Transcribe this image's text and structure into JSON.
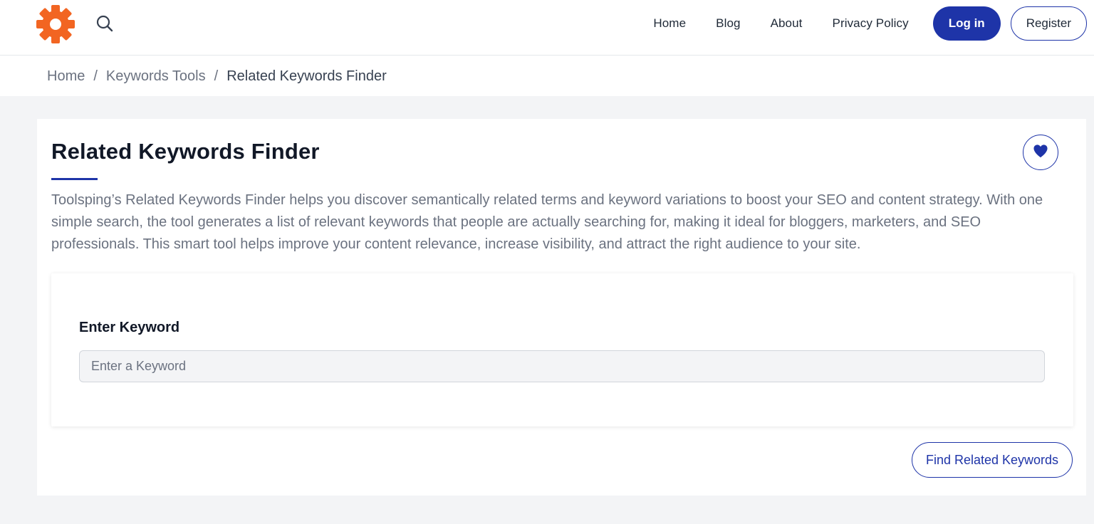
{
  "header": {
    "logo_icon": "gear-logo-icon",
    "search_icon": "search-icon",
    "nav": [
      {
        "label": "Home"
      },
      {
        "label": "Blog"
      },
      {
        "label": "About"
      },
      {
        "label": "Privacy Policy"
      }
    ],
    "login_label": "Log in",
    "register_label": "Register"
  },
  "breadcrumb": {
    "items": [
      "Home",
      "Keywords Tools"
    ],
    "separator": "/",
    "current": "Related Keywords Finder"
  },
  "main": {
    "title": "Related Keywords Finder",
    "favorite_icon": "heart-icon",
    "description": "Toolsping’s Related Keywords Finder helps you discover semantically related terms and keyword variations to boost your SEO and content strategy. With one simple search, the tool generates a list of relevant keywords that people are actually searching for, making it ideal for bloggers, marketers, and SEO professionals. This smart tool helps improve your content relevance, increase visibility, and attract the right audience to your site.",
    "form": {
      "label": "Enter Keyword",
      "placeholder": "Enter a Keyword",
      "value": ""
    },
    "submit_label": "Find Related Keywords"
  },
  "colors": {
    "brand_orange": "#f26522",
    "primary_blue": "#1e34a8",
    "background": "#f3f4f6"
  }
}
